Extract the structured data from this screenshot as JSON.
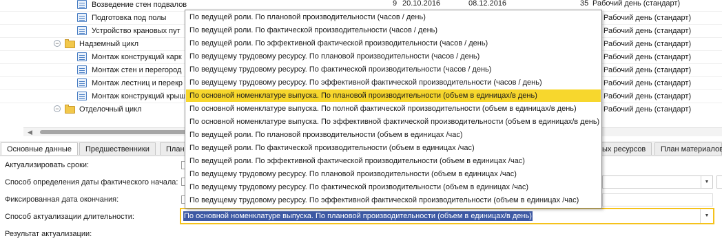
{
  "grid": {
    "rows": [
      {
        "name": "Возведение стен подвалов",
        "c1": "9",
        "c2": "20.10.2016",
        "c3": "08.12.2016",
        "c4": "35",
        "c5": "Рабочий день (стандарт)"
      },
      {
        "name": "Подготовка под полы",
        "c5": "Рабочий день (стандарт)"
      },
      {
        "name": "Устройство крановых пут",
        "c5": "Рабочий день (стандарт)"
      },
      {
        "name": "Надземный цикл",
        "c5": "Рабочий день (стандарт)"
      },
      {
        "name": "Монтаж конструкций карк",
        "c5": "Рабочий день (стандарт)"
      },
      {
        "name": "Монтаж стен и перегород",
        "c5": "Рабочий день (стандарт)"
      },
      {
        "name": "Монтаж лестниц и перекр",
        "c5": "Рабочий день (стандарт)"
      },
      {
        "name": "Монтаж конструкций крыш",
        "c5": "Рабочий день (стандарт)"
      },
      {
        "name": "Отделочный цикл",
        "c5": "Рабочий день (стандарт)"
      }
    ]
  },
  "tabs": [
    {
      "label": "Основные данные"
    },
    {
      "label": "Предшественники"
    },
    {
      "label": "План"
    },
    {
      "label": "ых ресурсов"
    },
    {
      "label": "План материалов"
    }
  ],
  "form": {
    "actualize_terms": "Актуализировать сроки:",
    "fact_start_method": "Способ определения даты фактического начала:",
    "fixed_end_date": "Фиксированная дата окончания:",
    "duration_method": "Способ актуализации длительности:",
    "duration_value": "По основной номенклатуре выпуска. По плановой производительности (объем в единицах/в день)",
    "result": "Результат актуализации:"
  },
  "dropdown": {
    "options": [
      "По ведущей роли. По плановой производительности (часов / день)",
      "По ведущей роли. По фактической производительности (часов / день)",
      "По ведущей роли. По эффективной фактической производительности (часов / день)",
      "По ведущему трудовому ресурсу. По плановой производительности (часов / день)",
      "По ведущему трудовому ресурсу. По фактической производительности (часов / день)",
      "По ведущему трудовому ресурсу. По эффективной фактической производительности (часов / день)",
      "По основной номенклатуре выпуска. По плановой производительности (объем в единицах/в день)",
      "По основной номенклатуре выпуска. По полной фактической производительности (объем в единицах/в день)",
      "По основной номенклатуре выпуска. По эффективной фактической производительности (объем в единицах/в день)",
      "По ведущей роли. По плановой производительности (объем в единицах /час)",
      "По ведущей роли. По фактической производительности (объем в единицах /час)",
      "По ведущей роли. По эффективной фактической производительности (объем в единицах /час)",
      "По ведущему трудовому ресурсу. По плановой производительности (объем в единицах /час)",
      "По ведущему трудовому ресурсу. По фактической производительности (объем в единицах /час)",
      "По ведущему трудовому ресурсу. По эффективной фактической производительности (объем в единицах /час)"
    ],
    "selected_index": 6
  },
  "colors": {
    "selection": "#f7d72d",
    "focus_border": "#f5c21b",
    "text_highlight": "#3d59a4"
  },
  "icons": {
    "task": "task-icon",
    "folder": "folder-icon",
    "collapse": "collapse-icon",
    "dropdown": "chevron-down-icon"
  }
}
